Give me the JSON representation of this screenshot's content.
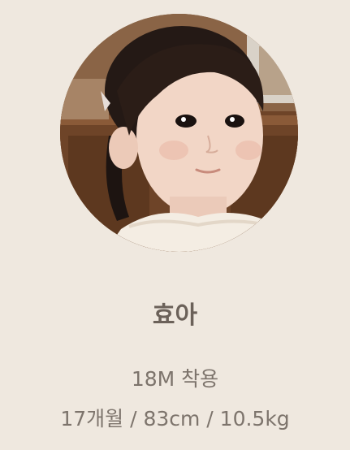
{
  "profile": {
    "name": "효아",
    "size_label": "18M 착용",
    "stats": "17개월 / 83cm / 10.5kg"
  },
  "colors": {
    "background": "#efe8df",
    "name_text": "#6b6159",
    "detail_text": "#7d746c"
  },
  "icons": {
    "avatar": "child-portrait-photo"
  }
}
